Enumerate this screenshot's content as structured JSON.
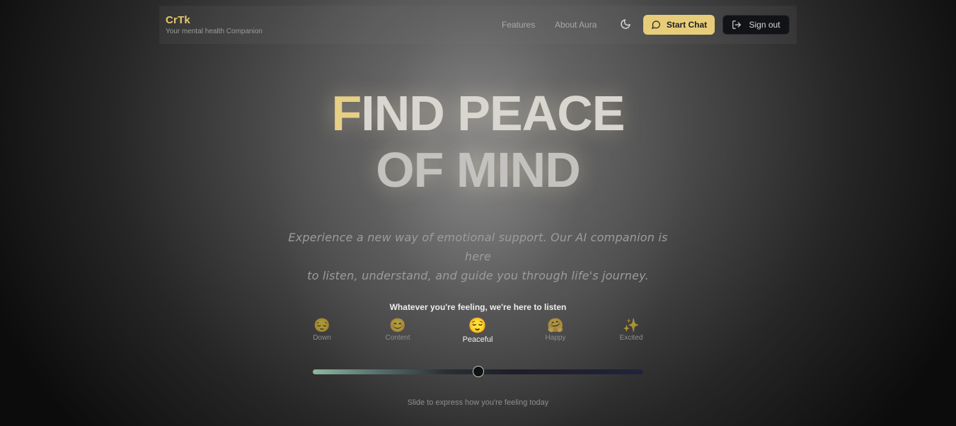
{
  "brand": {
    "title": "CrTk",
    "subtitle": "Your mental health Companion"
  },
  "nav": {
    "links": [
      "Features",
      "About Aura"
    ],
    "theme_icon": "moon-icon",
    "start_chat_label": "Start Chat",
    "start_chat_icon": "chat-bubble-icon",
    "sign_out_label": "Sign out",
    "sign_out_icon": "logout-icon"
  },
  "hero": {
    "title_first_letter": "F",
    "title_line1_rest": "IND PEACE",
    "title_line2": "OF MIND",
    "subtitle_line1": "Experience a new way of emotional support. Our AI companion is here",
    "subtitle_line2": "to listen, understand, and guide you through life's journey."
  },
  "mood": {
    "caption": "Whatever you're feeling, we're here to listen",
    "options": [
      {
        "emoji": "😔",
        "label": "Down"
      },
      {
        "emoji": "😊",
        "label": "Content"
      },
      {
        "emoji": "😌",
        "label": "Peaceful"
      },
      {
        "emoji": "🤗",
        "label": "Happy"
      },
      {
        "emoji": "✨",
        "label": "Excited"
      }
    ],
    "selected_index": 2,
    "slider_value": 0.5,
    "slider_caption": "Slide to express how you're feeling today"
  },
  "colors": {
    "accent": "#e7cd7a",
    "dark_button": "#111316"
  }
}
